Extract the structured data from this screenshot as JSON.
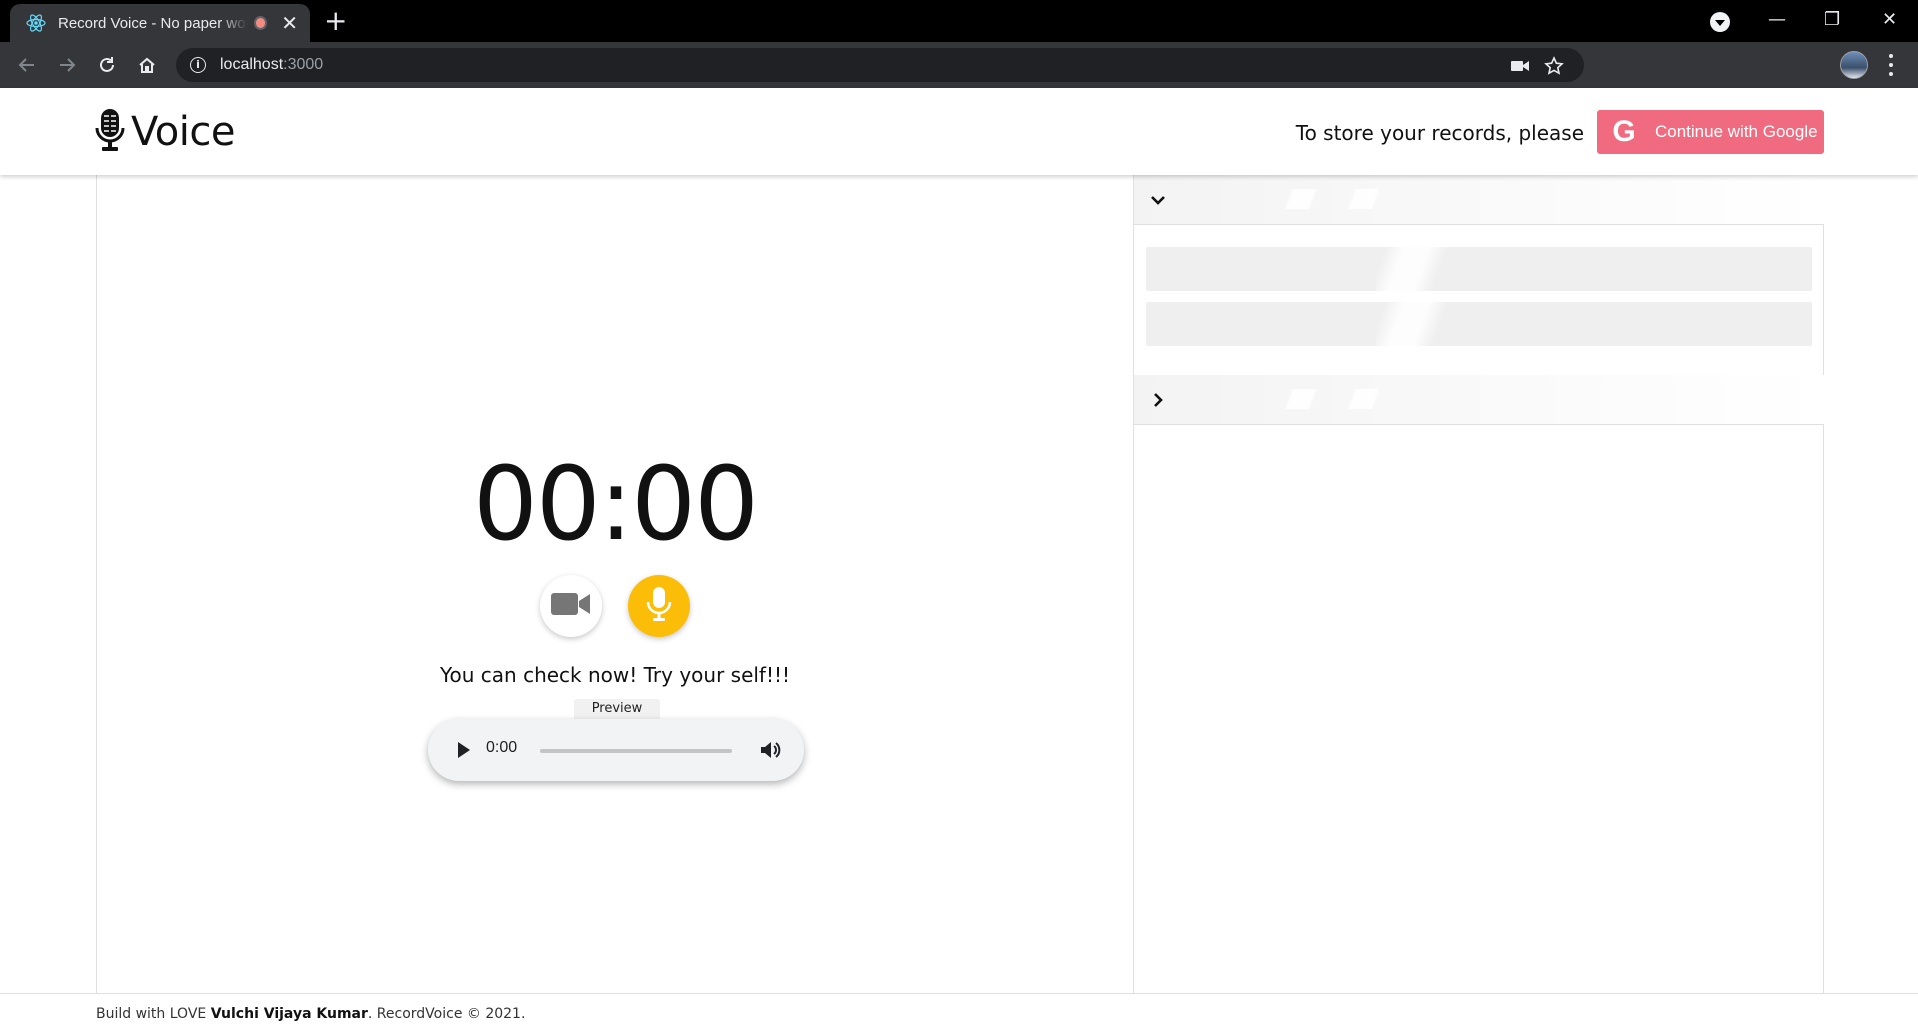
{
  "browser": {
    "tab_title": "Record Voice - No paper work",
    "new_tab": "+",
    "close_tab": "✕",
    "url_host": "localhost",
    "url_port": ":3000",
    "window_minimize": "—",
    "window_restore": "❐",
    "window_close": "✕"
  },
  "header": {
    "brand": "Voice",
    "store_prompt": "To store your records, please",
    "google_button_label": "Continue with Google",
    "google_glyph": "G"
  },
  "recorder": {
    "timer": "00:00",
    "message": "You can check now! Try your self!!!",
    "preview_label": "Preview",
    "player_time": "0:00"
  },
  "footer": {
    "prefix": "Build with LOVE ",
    "author": "Vulchi Vijaya Kumar",
    "suffix": ". RecordVoice © 2021."
  },
  "colors": {
    "mic_button": "#fbbd08",
    "google_button": "#f06b7f",
    "chrome_toolbar": "#35363a"
  },
  "icons": [
    "react-icon",
    "microphone-icon",
    "video-camera-icon",
    "play-icon",
    "volume-icon",
    "chevron-down-icon",
    "chevron-right-icon"
  ]
}
